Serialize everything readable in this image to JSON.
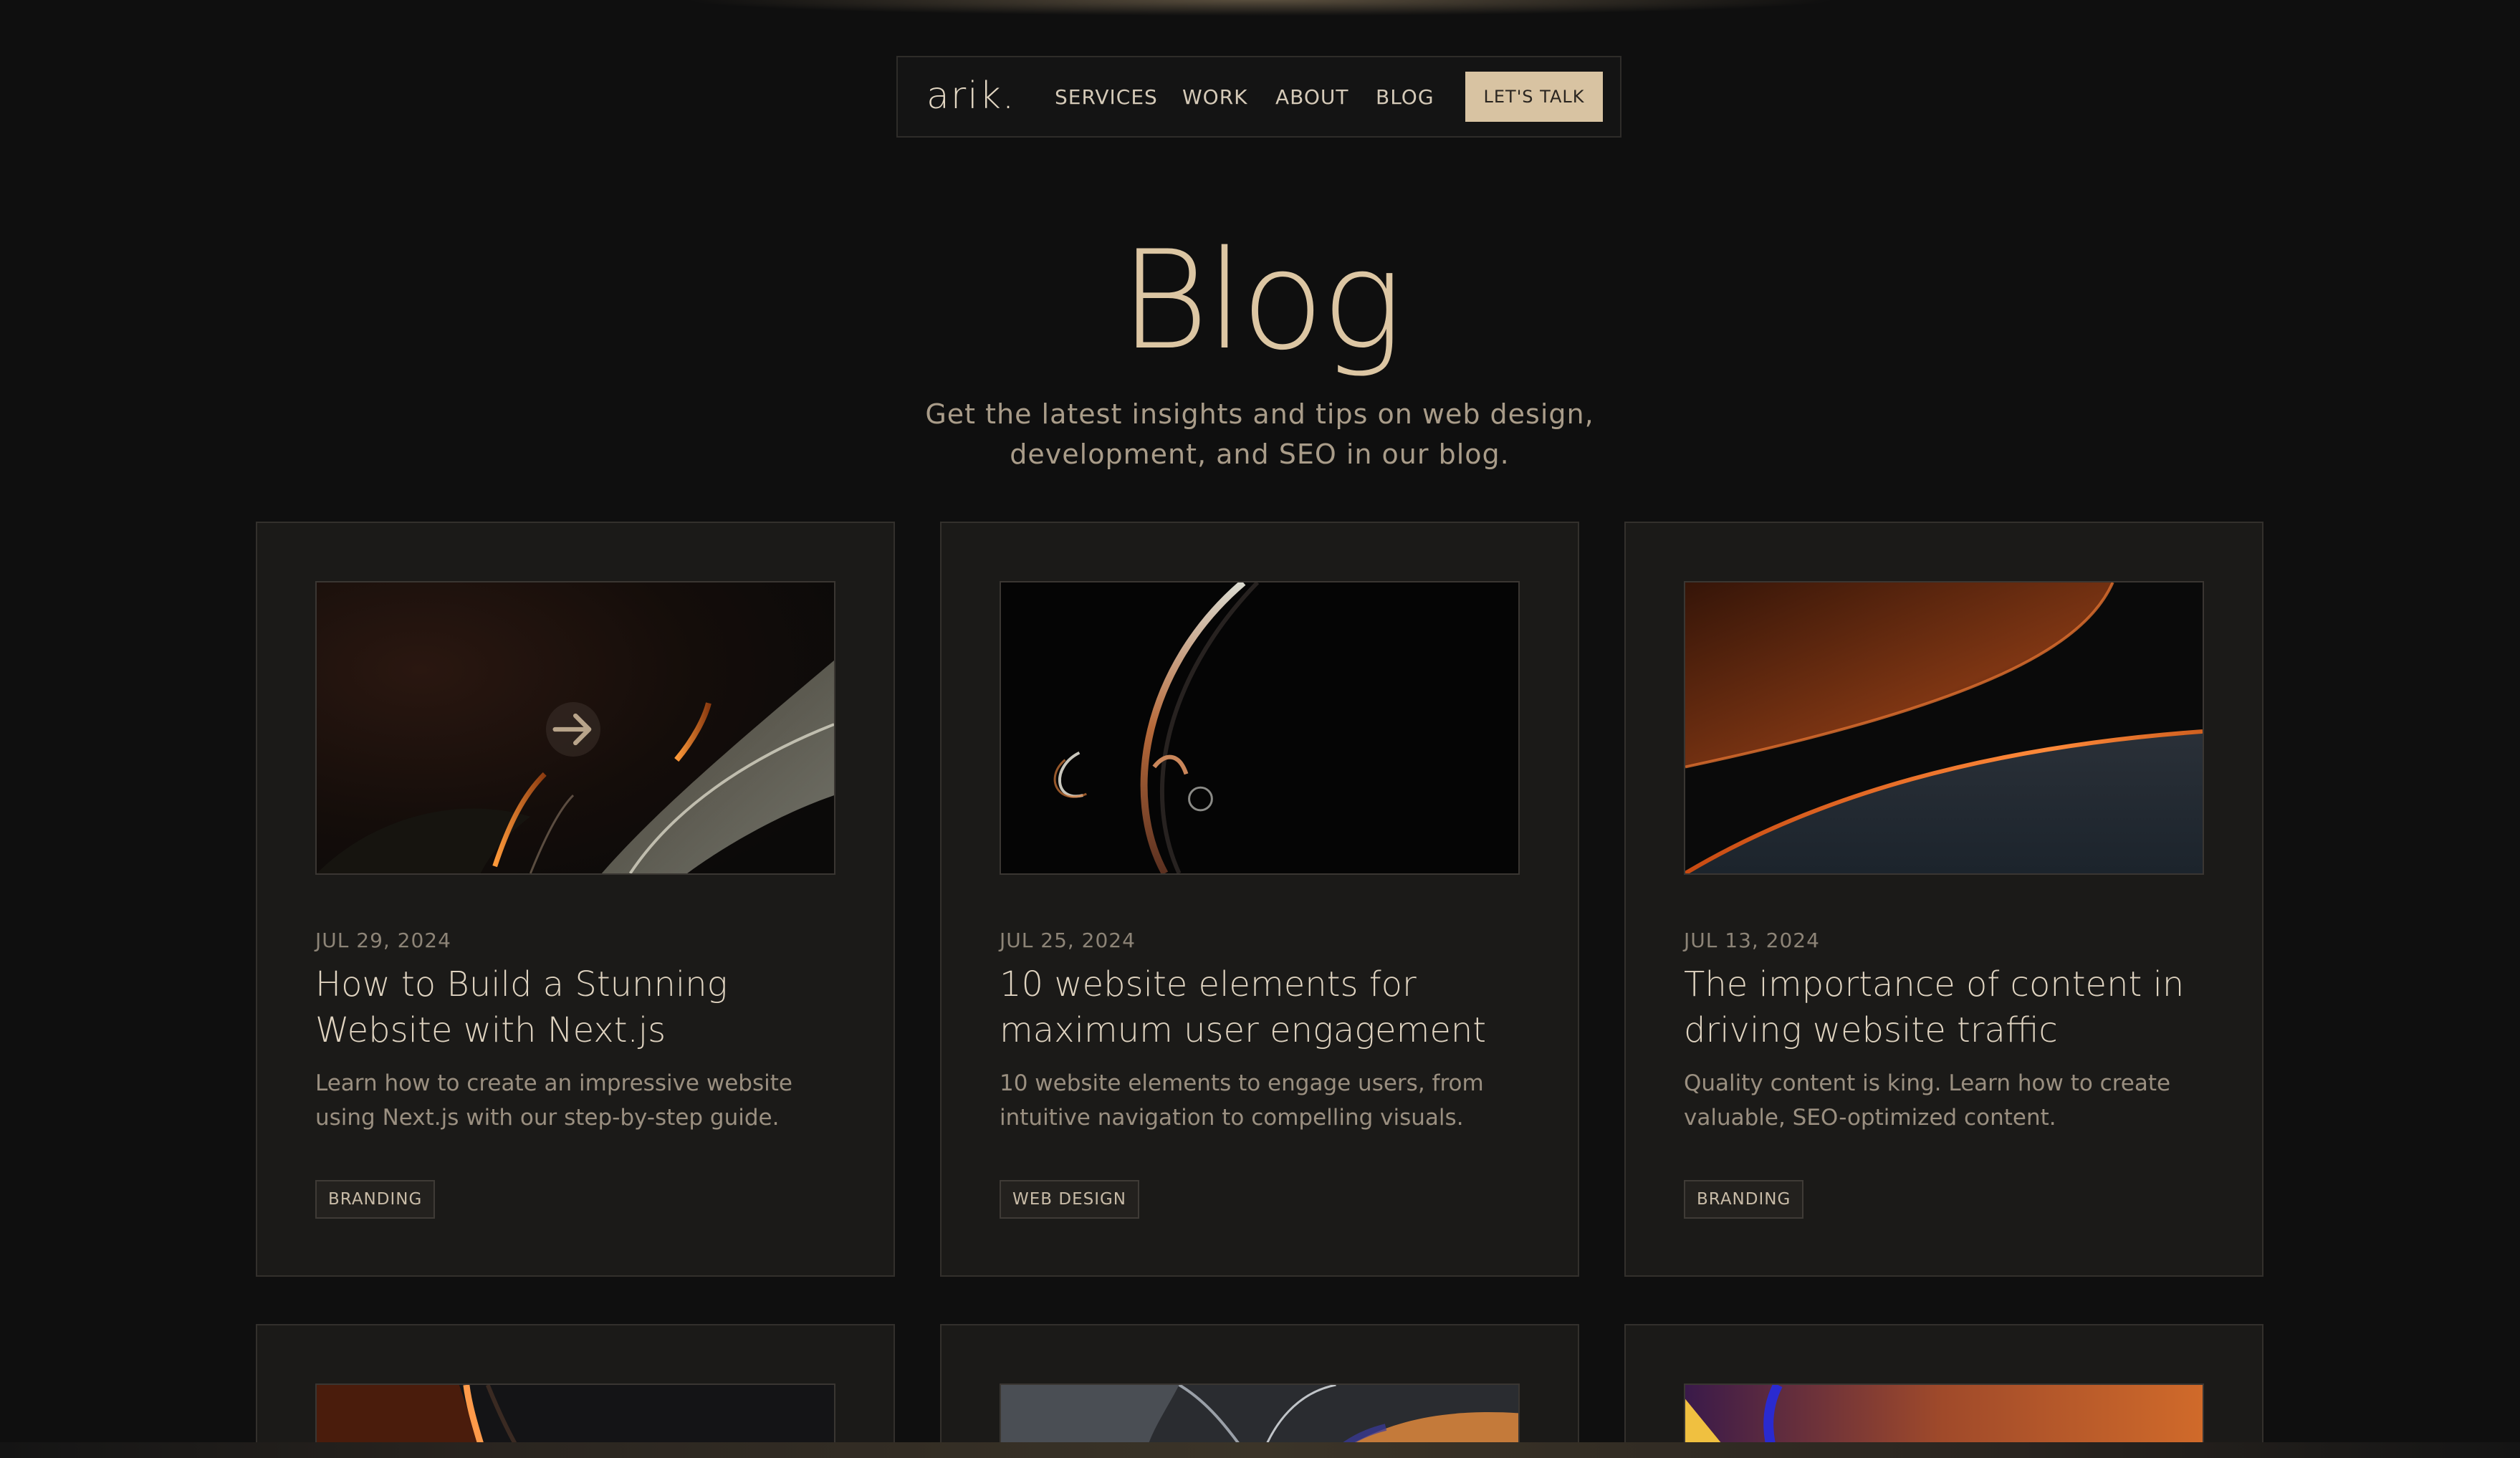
{
  "nav": {
    "logo": "arik.",
    "links": [
      "SERVICES",
      "WORK",
      "ABOUT",
      "BLOG"
    ],
    "cta": "LET'S TALK"
  },
  "hero": {
    "title": "Blog",
    "subtitle_line1": "Get the latest insights and tips on web design,",
    "subtitle_line2": "development, and SEO in our blog."
  },
  "posts": [
    {
      "date": "JUL 29, 2024",
      "title": "How to Build a Stunning Website with Next.js",
      "description": "Learn how to create an impressive website using Next.js with our step-by-step guide.",
      "tag": "BRANDING"
    },
    {
      "date": "JUL 25, 2024",
      "title": "10 website elements for maximum user engagement",
      "description": "10 website elements to engage users, from intuitive navigation to compelling visuals.",
      "tag": "WEB DESIGN"
    },
    {
      "date": "JUL 13, 2024",
      "title": "The importance of content in driving website traffic",
      "description": "Quality content is king. Learn how to create valuable, SEO-optimized content.",
      "tag": "BRANDING"
    }
  ],
  "colors": {
    "background": "#0f0f0f",
    "card": "#1b1a18",
    "accent": "#d8c3a2",
    "title": "#dcc6a3"
  },
  "icons": {
    "card_hover": "arrow-right-icon"
  }
}
